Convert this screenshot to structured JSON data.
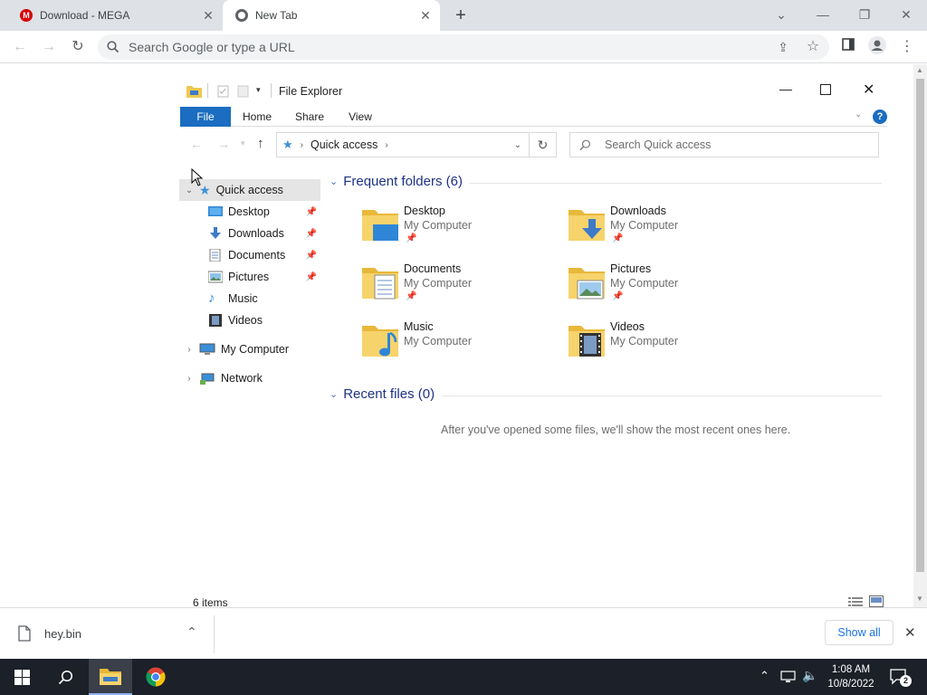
{
  "browser": {
    "tabs": [
      {
        "title": "Download - MEGA",
        "favicon": "mega-icon"
      },
      {
        "title": "New Tab",
        "favicon": "chrome-icon"
      }
    ],
    "omnibox_placeholder": "Search Google or type a URL"
  },
  "explorer": {
    "title": "File Explorer",
    "ribbon_tabs": [
      "File",
      "Home",
      "Share",
      "View"
    ],
    "breadcrumb": "Quick access",
    "search_placeholder": "Search Quick access",
    "tree": {
      "quick_access": "Quick access",
      "items": [
        {
          "label": "Desktop",
          "pinned": true
        },
        {
          "label": "Downloads",
          "pinned": true
        },
        {
          "label": "Documents",
          "pinned": true
        },
        {
          "label": "Pictures",
          "pinned": true
        },
        {
          "label": "Music",
          "pinned": false
        },
        {
          "label": "Videos",
          "pinned": false
        }
      ],
      "my_computer": "My Computer",
      "network": "Network"
    },
    "frequent_header": "Frequent folders (6)",
    "folders": [
      {
        "name": "Desktop",
        "location": "My Computer",
        "pinned": true
      },
      {
        "name": "Downloads",
        "location": "My Computer",
        "pinned": true
      },
      {
        "name": "Documents",
        "location": "My Computer",
        "pinned": true
      },
      {
        "name": "Pictures",
        "location": "My Computer",
        "pinned": true
      },
      {
        "name": "Music",
        "location": "My Computer",
        "pinned": false
      },
      {
        "name": "Videos",
        "location": "My Computer",
        "pinned": false
      }
    ],
    "recent_header": "Recent files (0)",
    "recent_empty": "After you've opened some files, we'll show the most recent ones here.",
    "status": "6 items"
  },
  "download_bar": {
    "file": "hey.bin",
    "show_all": "Show all"
  },
  "taskbar": {
    "time": "1:08 AM",
    "date": "10/8/2022",
    "notifications": "2"
  },
  "colors": {
    "ribbon_file": "#1a6dc0",
    "group_header": "#1e3287",
    "folder_yellow": "#f0c850",
    "taskbar": "#1c2028"
  }
}
